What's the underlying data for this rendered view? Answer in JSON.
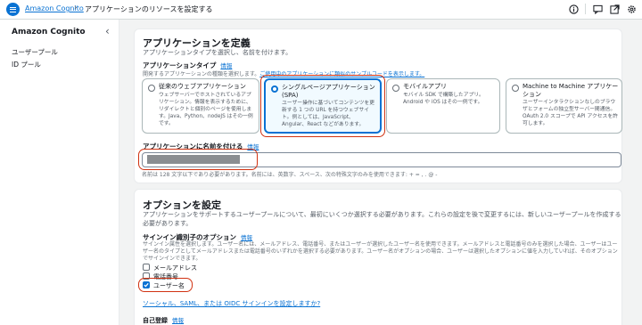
{
  "topbar": {
    "service_link": "Amazon Cognito",
    "separator": "›",
    "current_page": "アプリケーションのリソースを設定する"
  },
  "sidebar": {
    "title": "Amazon Cognito",
    "collapse_icon": "‹",
    "items": [
      {
        "label": "ユーザープール"
      },
      {
        "label": "ID プール"
      }
    ]
  },
  "define_app": {
    "title": "アプリケーションを定義",
    "description": "アプリケーションタイプを選択し、名前を付けます。",
    "app_type_label": "アプリケーションタイプ",
    "info_link": "情報",
    "app_type_hint": "開発するアプリケーションの種類を選択します。",
    "app_type_hint_link": "ご使用中のアプリケーションに類似のサンプルコードを表示します。",
    "app_types": [
      {
        "title": "従来のウェブアプリケーション",
        "description": "ウェブサーバーでホストされているアプリケーション。情報を表示するために、リダイレクトと個別のページを使用します。Java、Python、nodeJS はその一例です。",
        "selected": false
      },
      {
        "title": "シングルページアプリケーション (SPA)",
        "description": "ユーザー操作に基づいてコンテンツを更新する 1 つの URL を持つウェブサイト。例としては、JavaScript、Angular、React などがあります。",
        "selected": true
      },
      {
        "title": "モバイルアプリ",
        "description": "モバイル SDK で構築したアプリ。Android や iOS はその一例です。",
        "selected": false
      },
      {
        "title": "Machine to Machine アプリケーション",
        "description": "ユーザーインタラクションなしのブラウザとフォームの独立型サーバー間通信。OAuth 2.0 スコープで API アクセスを許可します。",
        "selected": false
      }
    ],
    "name_label": "アプリケーションに名前を付ける",
    "name_info": "情報",
    "name_value": "",
    "name_hint": "名前は 128 文字以下であり必要があります。名前には、英数字、スペース、次の特殊文字のみを使用できます: + = , . @ -"
  },
  "options": {
    "title": "オプションを設定",
    "description": "アプリケーションをサポートするユーザープールについて、最初にいくつか選択する必要があります。これらの設定を後で変更するには、新しいユーザープールを作成する必要があります。",
    "signin_label": "サインイン識別子のオプション",
    "signin_info": "情報",
    "signin_hint": "サインイン属性を選択します。ユーザー名には、メールアドレス、電話番号、またはユーザーが選択したユーザー名を使用できます。メールアドレスと電話番号のみを選択した場合、ユーザーはユーザー名のタイプとしてメールアドレスまたは電話番号のいずれかを選択する必要があります。ユーザー名がオプションの場合、ユーザーは選択したオプションに値を入力していれば、そのオプションでサインインできます。",
    "checkboxes": [
      {
        "label": "メールアドレス",
        "checked": false
      },
      {
        "label": "電話番号",
        "checked": false
      },
      {
        "label": "ユーザー名",
        "checked": true
      }
    ],
    "social_link": "ソーシャル、SAML、または OIDC サインインを設定しますか?",
    "self_registration_label": "自己登録",
    "self_registration_info": "情報"
  },
  "colors": {
    "accent": "#0972d3",
    "highlight": "#d13212"
  }
}
